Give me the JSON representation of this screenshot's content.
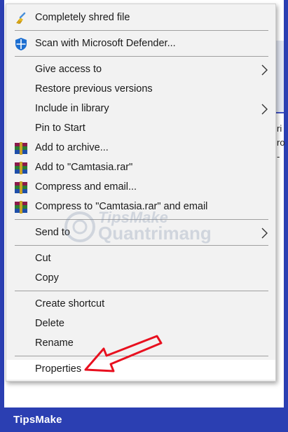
{
  "brand": "TipsMake",
  "watermark": {
    "line1": "TipsMake",
    "line2": "Quantrimang"
  },
  "background_text": [
    "ri",
    "ro",
    "-"
  ],
  "menu": {
    "items": [
      {
        "label": "Completely shred file",
        "icon": "shred-broom-icon"
      },
      {
        "label": "Scan with Microsoft Defender...",
        "icon": "defender-shield-icon"
      },
      {
        "label": "Give access to",
        "submenu": true
      },
      {
        "label": "Restore previous versions"
      },
      {
        "label": "Include in library",
        "submenu": true
      },
      {
        "label": "Pin to Start"
      },
      {
        "label": "Add to archive...",
        "icon": "winrar-icon"
      },
      {
        "label": "Add to \"Camtasia.rar\"",
        "icon": "winrar-icon"
      },
      {
        "label": "Compress and email...",
        "icon": "winrar-icon"
      },
      {
        "label": "Compress to \"Camtasia.rar\" and email",
        "icon": "winrar-icon"
      },
      {
        "label": "Send to",
        "submenu": true
      },
      {
        "label": "Cut"
      },
      {
        "label": "Copy"
      },
      {
        "label": "Create shortcut"
      },
      {
        "label": "Delete"
      },
      {
        "label": "Rename"
      },
      {
        "label": "Properties",
        "highlighted": true
      }
    ]
  },
  "colors": {
    "frame_blue": "#2b3fb2",
    "menu_bg": "#f2f2f2",
    "arrow_red": "#e8101f",
    "defender_blue": "#1d6fd1"
  }
}
